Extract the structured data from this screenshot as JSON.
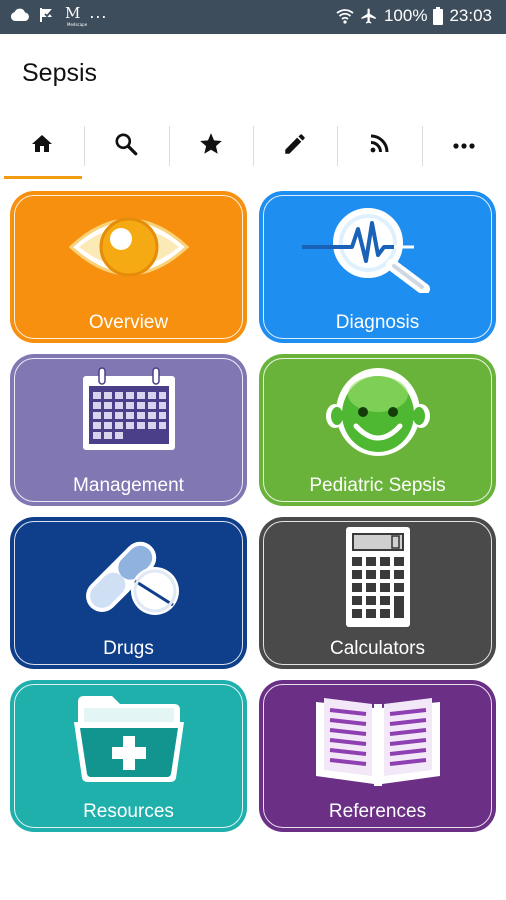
{
  "status_bar": {
    "battery": "100%",
    "time": "23:03",
    "more": "...",
    "logo_letter": "M",
    "logo_sub": "Medscape"
  },
  "app": {
    "title": "Sepsis"
  },
  "tabs": [
    {
      "name": "home",
      "icon": "home-icon",
      "active": true
    },
    {
      "name": "search",
      "icon": "search-icon"
    },
    {
      "name": "favorites",
      "icon": "star-icon"
    },
    {
      "name": "notes",
      "icon": "pencil-icon"
    },
    {
      "name": "feed",
      "icon": "rss-icon"
    },
    {
      "name": "more",
      "icon": "more-icon"
    }
  ],
  "tiles": [
    {
      "label": "Overview",
      "color": "#f7900f",
      "icon": "eye-icon"
    },
    {
      "label": "Diagnosis",
      "color": "#1e8ef0",
      "icon": "magnifier-pulse-icon"
    },
    {
      "label": "Management",
      "color": "#8077b3",
      "icon": "calendar-icon"
    },
    {
      "label": "Pediatric Sepsis",
      "color": "#6ab33a",
      "icon": "child-face-icon"
    },
    {
      "label": "Drugs",
      "color": "#0f3f8b",
      "icon": "pills-icon"
    },
    {
      "label": "Calculators",
      "color": "#4a4a4a",
      "icon": "calculator-icon"
    },
    {
      "label": "Resources",
      "color": "#1fb0ac",
      "icon": "medical-folder-icon"
    },
    {
      "label": "References",
      "color": "#6b2f86",
      "icon": "book-icon"
    }
  ],
  "accent_color": "#f39c12"
}
